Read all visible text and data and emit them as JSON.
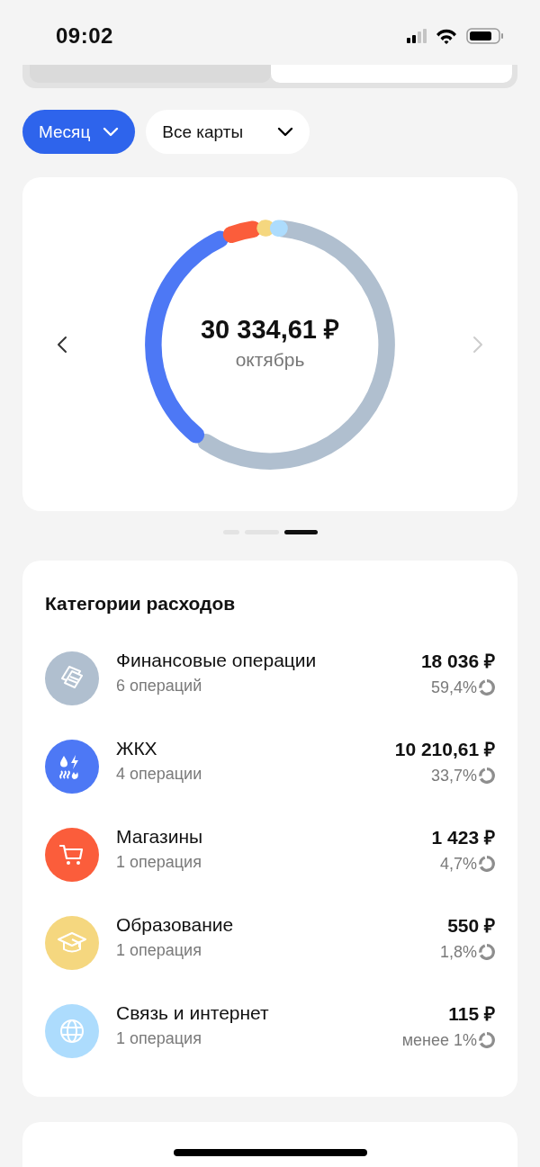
{
  "status_bar": {
    "time": "09:02"
  },
  "segmented_control": {
    "segments": [
      {
        "selected": false
      },
      {
        "selected": true
      }
    ]
  },
  "filters": [
    {
      "label": "Месяц",
      "selected": true
    },
    {
      "label": "Все карты",
      "selected": false
    }
  ],
  "summary": {
    "total": "30 334,61 ₽",
    "period": "октябрь",
    "prev_enabled": true,
    "next_enabled": false
  },
  "pager": [
    {
      "selected": false
    },
    {
      "selected": false
    },
    {
      "selected": true
    }
  ],
  "categories": {
    "title": "Категории расходов",
    "items": [
      {
        "kind": "finance",
        "name": "Финансовые операции",
        "count": "6 операций",
        "amount": "18 036 ₽",
        "share": "59,4%",
        "color": "#b0bfcf"
      },
      {
        "kind": "utilities",
        "name": "ЖКХ",
        "count": "4 операции",
        "amount": "10 210,61 ₽",
        "share": "33,7%",
        "color": "#4d78f5"
      },
      {
        "kind": "shops",
        "name": "Магазины",
        "count": "1 операция",
        "amount": "1 423 ₽",
        "share": "4,7%",
        "color": "#fb5d3b"
      },
      {
        "kind": "education",
        "name": "Образование",
        "count": "1 операция",
        "amount": "550 ₽",
        "share": "1,8%",
        "color": "#f5d77f"
      },
      {
        "kind": "internet",
        "name": "Связь и интернет",
        "count": "1 операция",
        "amount": "115 ₽",
        "share": "менее 1%",
        "color": "#addcfd"
      }
    ]
  }
}
